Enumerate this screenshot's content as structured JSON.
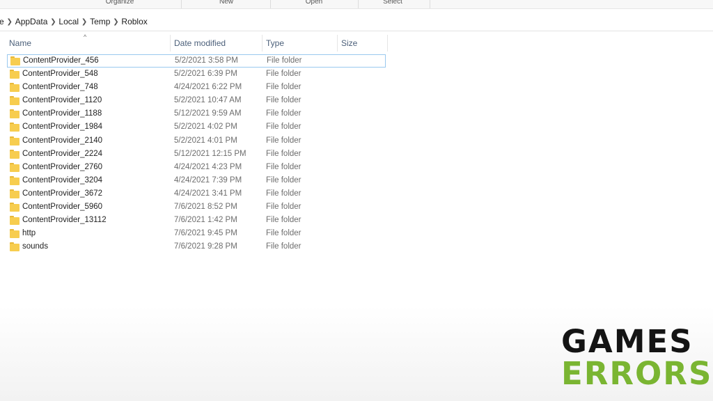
{
  "ribbon": {
    "groups": [
      "Organize",
      "New",
      "Open",
      "Select"
    ]
  },
  "address": {
    "crumbs": [
      "e",
      "AppData",
      "Local",
      "Temp",
      "Roblox"
    ]
  },
  "columns": {
    "name": "Name",
    "date": "Date modified",
    "type": "Type",
    "size": "Size",
    "sort_indicator": "^"
  },
  "files": [
    {
      "name": "ContentProvider_456",
      "date": "5/2/2021 3:58 PM",
      "type": "File folder"
    },
    {
      "name": "ContentProvider_548",
      "date": "5/2/2021 6:39 PM",
      "type": "File folder"
    },
    {
      "name": "ContentProvider_748",
      "date": "4/24/2021 6:22 PM",
      "type": "File folder"
    },
    {
      "name": "ContentProvider_1120",
      "date": "5/2/2021 10:47 AM",
      "type": "File folder"
    },
    {
      "name": "ContentProvider_1188",
      "date": "5/12/2021 9:59 AM",
      "type": "File folder"
    },
    {
      "name": "ContentProvider_1984",
      "date": "5/2/2021 4:02 PM",
      "type": "File folder"
    },
    {
      "name": "ContentProvider_2140",
      "date": "5/2/2021 4:01 PM",
      "type": "File folder"
    },
    {
      "name": "ContentProvider_2224",
      "date": "5/12/2021 12:15 PM",
      "type": "File folder"
    },
    {
      "name": "ContentProvider_2760",
      "date": "4/24/2021 4:23 PM",
      "type": "File folder"
    },
    {
      "name": "ContentProvider_3204",
      "date": "4/24/2021 7:39 PM",
      "type": "File folder"
    },
    {
      "name": "ContentProvider_3672",
      "date": "4/24/2021 3:41 PM",
      "type": "File folder"
    },
    {
      "name": "ContentProvider_5960",
      "date": "7/6/2021 8:52 PM",
      "type": "File folder"
    },
    {
      "name": "ContentProvider_13112",
      "date": "7/6/2021 1:42 PM",
      "type": "File folder"
    },
    {
      "name": "http",
      "date": "7/6/2021 9:45 PM",
      "type": "File folder"
    },
    {
      "name": "sounds",
      "date": "7/6/2021 9:28 PM",
      "type": "File folder"
    }
  ],
  "watermark": {
    "line1": "GAMES",
    "line2": "ERRORS"
  },
  "colors": {
    "folder": "#f7cd4f",
    "focus_border": "#99c9ef",
    "logo_dark": "#141414",
    "logo_green": "#7ab532"
  }
}
